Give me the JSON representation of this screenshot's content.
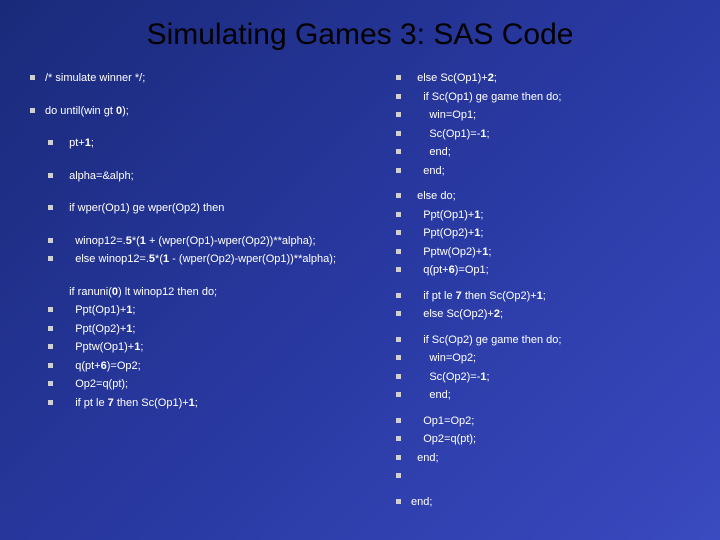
{
  "title": "Simulating Games 3:  SAS Code",
  "left": [
    {
      "t": "/* simulate winner */;",
      "gap": "gap"
    },
    {
      "t": "do until(win gt <b>0</b>);",
      "gap": "gap"
    },
    {
      "t": "  pt+<b>1</b>;",
      "gap": "gap",
      "ind": "ind1"
    },
    {
      "t": "  alpha=&alph;",
      "gap": "gap",
      "ind": "ind1"
    },
    {
      "t": "  if wper(Op1) ge wper(Op2) then",
      "gap": "gap",
      "ind": "ind1"
    },
    {
      "t": "    winop12=.<b>5</b>*(<b>1</b> + (wper(Op1)-wper(Op2))**alpha);",
      "ind": "ind1"
    },
    {
      "t": "    else winop12=.<b>5</b>*(<b>1</b> - (wper(Op2)-wper(Op1))**alpha);",
      "gap": "gap",
      "ind": "ind1"
    },
    {
      "t": "  if ranuni(<b>0</b>) lt winop12 then do;",
      "nobullet": true,
      "ind": "ind1"
    },
    {
      "t": "    Ppt(Op1)+<b>1</b>;",
      "ind": "ind1"
    },
    {
      "t": "    Ppt(Op2)+<b>1</b>;",
      "ind": "ind1"
    },
    {
      "t": "    Pptw(Op1)+<b>1</b>;",
      "ind": "ind1"
    },
    {
      "t": "    q(pt+<b>6</b>)=Op2;",
      "ind": "ind1"
    },
    {
      "t": "    Op2=q(pt);",
      "ind": "ind1"
    },
    {
      "t": "    if pt le <b>7</b> then Sc(Op1)+<b>1</b>;",
      "ind": "ind1"
    }
  ],
  "right": [
    {
      "t": "  else Sc(Op1)+<b>2</b>;"
    },
    {
      "t": "    if Sc(Op1) ge game then do;"
    },
    {
      "t": "      win=Op1;"
    },
    {
      "t": "      Sc(Op1)=-<b>1</b>;"
    },
    {
      "t": "      end;"
    },
    {
      "t": "    end;",
      "gap": "gap-sm"
    },
    {
      "t": "  else do;"
    },
    {
      "t": "    Ppt(Op1)+<b>1</b>;"
    },
    {
      "t": "    Ppt(Op2)+<b>1</b>;"
    },
    {
      "t": "    Pptw(Op2)+<b>1</b>;"
    },
    {
      "t": "    q(pt+<b>6</b>)=Op1;",
      "gap": "gap-sm"
    },
    {
      "t": "    if pt le <b>7</b> then Sc(Op2)+<b>1</b>;"
    },
    {
      "t": "    else Sc(Op2)+<b>2</b>;",
      "gap": "gap-sm"
    },
    {
      "t": "    if Sc(Op2) ge game then do;"
    },
    {
      "t": "      win=Op2;"
    },
    {
      "t": "      Sc(Op2)=-<b>1</b>;"
    },
    {
      "t": "      end;",
      "gap": "gap-sm"
    },
    {
      "t": "    Op1=Op2;"
    },
    {
      "t": "    Op2=q(pt);"
    },
    {
      "t": "  end;"
    },
    {
      "t": "",
      "gap": ""
    },
    {
      "t": "end;"
    }
  ]
}
